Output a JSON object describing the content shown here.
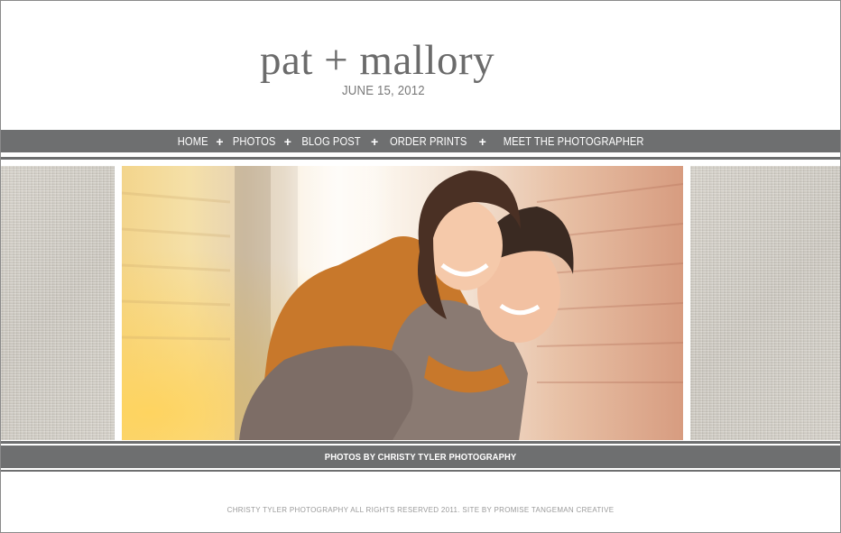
{
  "header": {
    "title": "pat + mallory",
    "date": "JUNE 15, 2012"
  },
  "nav": {
    "items": [
      {
        "label": "HOME"
      },
      {
        "label": "PHOTOS"
      },
      {
        "label": "BLOG POST"
      },
      {
        "label": "ORDER PRINTS"
      },
      {
        "label": "MEET THE PHOTOGRAPHER"
      }
    ],
    "separator": "+"
  },
  "hero": {
    "image": "couple-piggyback-photo"
  },
  "footer": {
    "credit": "PHOTOS BY CHRISTY TYLER PHOTOGRAPHY",
    "copyright": "CHRISTY TYLER PHOTOGRAPHY ALL RIGHTS RESERVED 2011. SITE BY PROMISE TANGEMAN CREATIVE"
  },
  "colors": {
    "bar": "#6e6f70",
    "title": "#6b6b6b",
    "linen": "#d8d4cc"
  }
}
